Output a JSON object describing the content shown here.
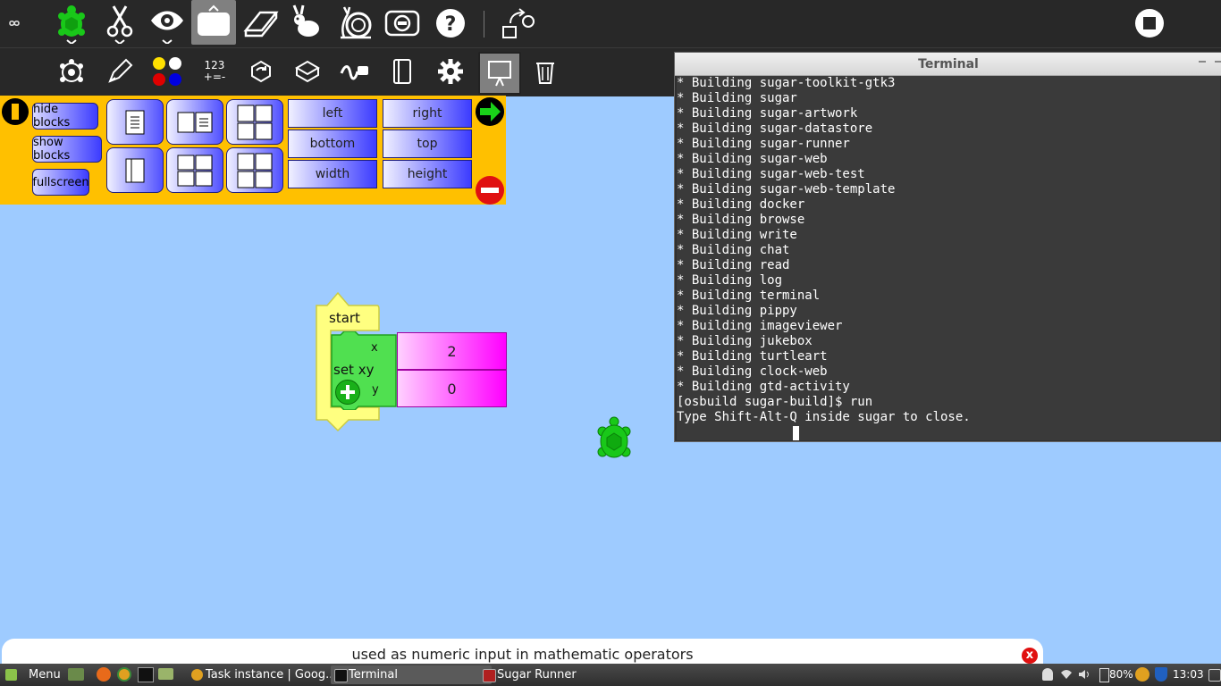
{
  "toolbar1": {
    "items": [
      "activity-icon",
      "turtle-icon",
      "cut-icon",
      "view-icon",
      "toolbar-toggle-icon",
      "eraser-icon",
      "run-fast-icon",
      "run-slow-icon",
      "run-step-icon",
      "help-icon",
      "load-project-icon",
      "stop-icon"
    ]
  },
  "toolbar2": {
    "number_label": "123\n+=-"
  },
  "palette": {
    "buttons": {
      "hide": "hide blocks",
      "show": "show blocks",
      "fullscreen": "fullscreen"
    },
    "numbers": {
      "left": "left",
      "right": "right",
      "bottom": "bottom",
      "top": "top",
      "width": "width",
      "height": "height"
    }
  },
  "canvas": {
    "start_label": "start",
    "setxy_label": "set xy",
    "x_label": "x",
    "y_label": "y",
    "x_value": "2",
    "y_value": "0"
  },
  "terminal": {
    "title": "Terminal",
    "lines": [
      "* Building sugar-toolkit-gtk3",
      "* Building sugar",
      "* Building sugar-artwork",
      "* Building sugar-datastore",
      "* Building sugar-runner",
      "* Building sugar-web",
      "* Building sugar-web-test",
      "* Building sugar-web-template",
      "* Building docker",
      "* Building browse",
      "* Building write",
      "* Building chat",
      "* Building read",
      "* Building log",
      "* Building terminal",
      "* Building pippy",
      "* Building imageviewer",
      "* Building jukebox",
      "* Building turtleart",
      "* Building clock-web",
      "* Building gtd-activity",
      "[osbuild sugar-build]$ run",
      "Type Shift-Alt-Q inside sugar to close."
    ]
  },
  "help": {
    "text": "used as numeric input in mathematic operators",
    "close": "x"
  },
  "taskbar": {
    "menu": "Menu",
    "tasks": [
      "Task instance | Goog...",
      "Terminal",
      "Sugar Runner"
    ],
    "battery": "80%",
    "clock": "13:03"
  },
  "colors": {
    "canvas": "#9ecbff",
    "palette": "#ffc000",
    "turtle": "#19c819",
    "number_block": "#ff00ff",
    "start_block": "#ffff80"
  }
}
